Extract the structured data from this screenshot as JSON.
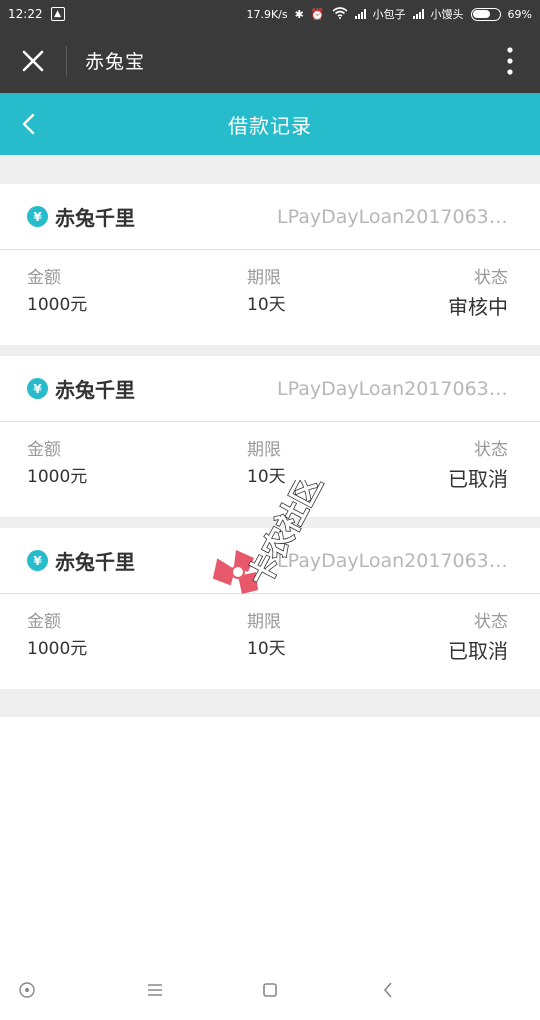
{
  "status_bar": {
    "time": "12:22",
    "network_speed": "17.9K/s",
    "carrier1": "小包子",
    "carrier2": "小馒头",
    "battery": "69%",
    "battery_level": 0.69
  },
  "title_bar": {
    "app_name": "赤兔宝"
  },
  "nav_bar": {
    "title": "借款记录"
  },
  "labels": {
    "amount": "金额",
    "term": "期限",
    "status": "状态"
  },
  "records": [
    {
      "product": "赤兔千里",
      "loan_id": "LPayDayLoan2017063…",
      "amount": "1000元",
      "term": "10天",
      "status": "审核中"
    },
    {
      "product": "赤兔千里",
      "loan_id": "LPayDayLoan2017063…",
      "amount": "1000元",
      "term": "10天",
      "status": "已取消"
    },
    {
      "product": "赤兔千里",
      "loan_id": "LPayDayLoan2017063…",
      "amount": "1000元",
      "term": "10天",
      "status": "已取消"
    }
  ],
  "watermark_text": "卡农社区",
  "colors": {
    "accent": "#26bccc",
    "header_bg": "#3a3a3a"
  }
}
